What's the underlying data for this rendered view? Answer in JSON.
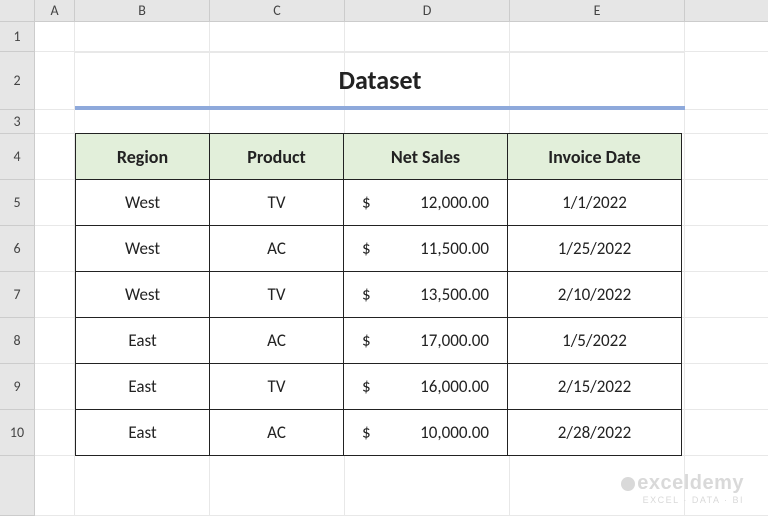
{
  "cols": {
    "A": "A",
    "B": "B",
    "C": "C",
    "D": "D",
    "E": "E"
  },
  "rownums": {
    "1": "1",
    "2": "2",
    "3": "3",
    "4": "4",
    "5": "5",
    "6": "6",
    "7": "7",
    "8": "8",
    "9": "9",
    "10": "10"
  },
  "title": "Dataset",
  "headers": {
    "region": "Region",
    "product": "Product",
    "netsales": "Net Sales",
    "invoice": "Invoice Date"
  },
  "rows": [
    {
      "region": "West",
      "product": "TV",
      "sales_sym": "$",
      "sales": "12,000.00",
      "date": "1/1/2022"
    },
    {
      "region": "West",
      "product": "AC",
      "sales_sym": "$",
      "sales": "11,500.00",
      "date": "1/25/2022"
    },
    {
      "region": "West",
      "product": "TV",
      "sales_sym": "$",
      "sales": "13,500.00",
      "date": "2/10/2022"
    },
    {
      "region": "East",
      "product": "AC",
      "sales_sym": "$",
      "sales": "17,000.00",
      "date": "1/5/2022"
    },
    {
      "region": "East",
      "product": "TV",
      "sales_sym": "$",
      "sales": "16,000.00",
      "date": "2/15/2022"
    },
    {
      "region": "East",
      "product": "AC",
      "sales_sym": "$",
      "sales": "10,000.00",
      "date": "2/28/2022"
    }
  ],
  "watermark": {
    "brand": "exceldemy",
    "tag": "EXCEL · DATA · BI"
  }
}
